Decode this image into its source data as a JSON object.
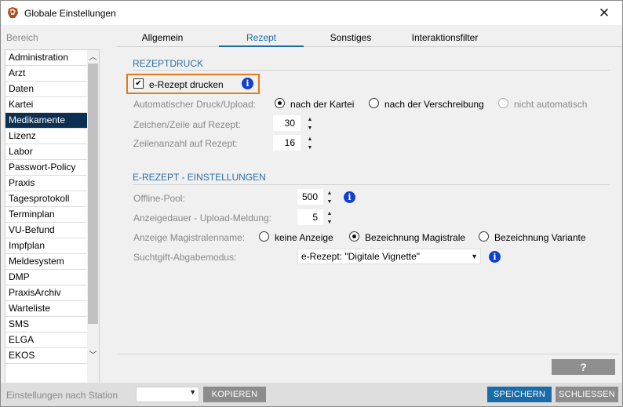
{
  "window": {
    "title": "Globale Einstellungen",
    "close_glyph": "✕"
  },
  "sidebar": {
    "label": "Bereich",
    "items": [
      "Administration",
      "Arzt",
      "Daten",
      "Kartei",
      "Medikamente",
      "Lizenz",
      "Labor",
      "Passwort-Policy",
      "Praxis",
      "Tagesprotokoll",
      "Terminplan",
      "VU-Befund",
      "Impfplan",
      "Meldesystem",
      "DMP",
      "PraxisArchiv",
      "Warteliste",
      "SMS",
      "ELGA",
      "EKOS"
    ],
    "selected_index": 4
  },
  "tabs": [
    {
      "label": "Allgemein",
      "active": false
    },
    {
      "label": "Rezept",
      "active": true
    },
    {
      "label": "Sonstiges",
      "active": false
    },
    {
      "label": "Interaktionsfilter",
      "active": false
    }
  ],
  "rezeptdruck": {
    "heading": "REZEPTDRUCK",
    "erezept_checkbox_label": "e-Rezept drucken",
    "erezept_checked": true,
    "auto_print_label": "Automatischer Druck/Upload:",
    "auto_print_options": [
      "nach der Kartei",
      "nach der Verschreibung",
      "nicht automatisch"
    ],
    "auto_print_selected": 0,
    "chars_label": "Zeichen/Zeile auf Rezept:",
    "chars_value": "30",
    "lines_label": "Zeilenanzahl auf Rezept:",
    "lines_value": "16"
  },
  "erezept": {
    "heading": "E-REZEPT - EINSTELLUNGEN",
    "offline_pool_label": "Offline-Pool:",
    "offline_pool_value": "500",
    "duration_label": "Anzeigedauer - Upload-Meldung:",
    "duration_value": "5",
    "magistral_label": "Anzeige Magistralenname:",
    "magistral_options": [
      "keine Anzeige",
      "Bezeichnung Magistrale",
      "Bezeichnung Variante"
    ],
    "magistral_selected": 1,
    "suchtgift_label": "Suchtgift-Abgabemodus:",
    "suchtgift_value": "e-Rezept: \"Digitale Vignette\""
  },
  "help_button": "?",
  "footer": {
    "station_label": "Einstellungen nach Station",
    "copy_button": "KOPIEREN",
    "save_button": "SPEICHERN",
    "close_button": "SCHLIESSEN"
  },
  "colors": {
    "accent": "#1a6ca8",
    "selected_bg": "#0c2f52",
    "highlight": "#e07a1c",
    "info": "#1040d0"
  }
}
